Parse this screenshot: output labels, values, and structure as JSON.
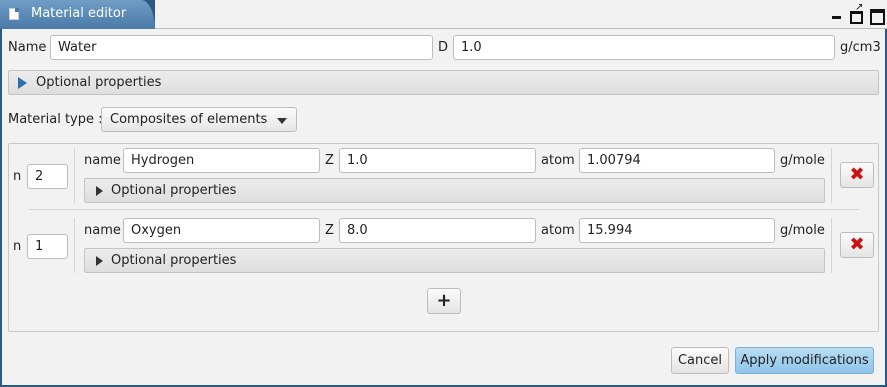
{
  "window": {
    "title": "Material editor",
    "icons": [
      "document-icon",
      "minimize-icon",
      "detach-icon",
      "maximize-icon"
    ]
  },
  "material": {
    "name_label": "Name",
    "name_value": "Water",
    "density_label": "D",
    "density_value": "1.0",
    "density_unit": "g/cm3",
    "optional_label": "Optional properties",
    "type_label": "Material type :",
    "type_value": "Composites of elements"
  },
  "components": [
    {
      "n_label": "n",
      "n_value": "2",
      "name_label": "name",
      "name_value": "Hydrogen",
      "z_label": "Z",
      "z_value": "1.0",
      "atom_label": "atom",
      "atom_value": "1.00794",
      "atom_unit": "g/mole",
      "optional_label": "Optional properties",
      "delete_icon": "close-icon"
    },
    {
      "n_label": "n",
      "n_value": "1",
      "name_label": "name",
      "name_value": "Oxygen",
      "z_label": "Z",
      "z_value": "8.0",
      "atom_label": "atom",
      "atom_value": "15.994",
      "atom_unit": "g/mole",
      "optional_label": "Optional properties",
      "delete_icon": "close-icon"
    }
  ],
  "add_button": "+",
  "footer": {
    "cancel_label": "Cancel",
    "apply_label": "Apply modifications"
  },
  "colors": {
    "accent": "#2a6fb0",
    "delete": "#cc1111",
    "apply_bg": "#9fcdee"
  }
}
